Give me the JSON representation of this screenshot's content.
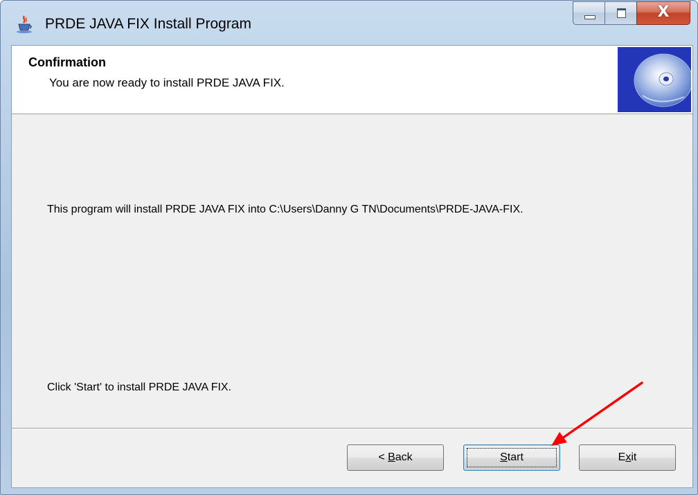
{
  "window": {
    "title": "PRDE JAVA FIX Install Program",
    "icon": "java-cup-icon"
  },
  "caption_buttons": {
    "minimize_icon": "minimize-icon",
    "maximize_icon": "maximize-icon",
    "close_glyph": "X"
  },
  "header": {
    "title": "Confirmation",
    "subtitle": "You are now ready to install PRDE JAVA FIX.",
    "image_icon": "cd-disc-icon"
  },
  "body": {
    "install_path_text": "This program will install PRDE JAVA FIX into C:\\Users\\Danny G TN\\Documents\\PRDE-JAVA-FIX.",
    "instruction_text": "Click 'Start' to install PRDE JAVA FIX."
  },
  "buttons": {
    "back": {
      "prefix": "< ",
      "mnemonic": "B",
      "rest": "ack"
    },
    "start": {
      "mnemonic": "S",
      "rest": "tart"
    },
    "exit": {
      "prefix": "E",
      "mnemonic": "x",
      "rest": "it"
    }
  },
  "annotation": {
    "arrow_color": "#ff0000",
    "points_to": "start-button"
  },
  "colors": {
    "dialog_background": "#f0f0f0",
    "header_background": "#ffffff",
    "close_button": "#c2452b",
    "focus_border": "#3c7fb1"
  }
}
